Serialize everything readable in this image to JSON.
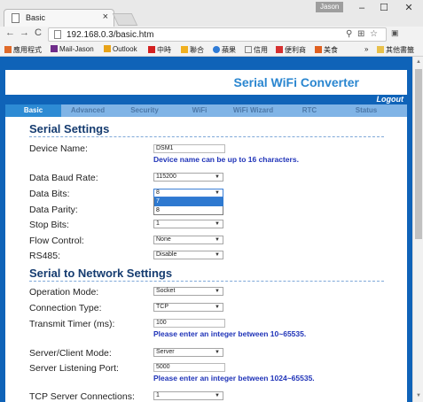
{
  "browser": {
    "tab_title": "Basic",
    "tab_close": "×",
    "user_badge": "Jason",
    "window_minimize": "–",
    "window_maximize": "☐",
    "window_close": "✕",
    "nav_back": "←",
    "nav_forward": "→",
    "nav_reload": "C",
    "url": "192.168.0.3/basic.htm",
    "menu": "⋮",
    "bookmarks": [
      "應用程式",
      "Mail-Jason",
      "Outlook",
      "中時",
      "聯合",
      "蘋果",
      "信用",
      "便利商",
      "美食"
    ],
    "bookmarks_more": "»",
    "other_bookmarks": "其他書籤"
  },
  "header": {
    "brand": "Serial WiFi Converter",
    "logout": "Logout"
  },
  "nav_tabs": [
    "Basic",
    "Advanced",
    "Security",
    "WiFi",
    "WiFi Wizard",
    "RTC",
    "Status"
  ],
  "serial_settings": {
    "title": "Serial Settings",
    "device_name_label": "Device Name:",
    "device_name_value": "DSM1",
    "device_name_hint": "Device name can be up to 16 characters.",
    "baud_rate_label": "Data Baud Rate:",
    "baud_rate_value": "115200",
    "data_bits_label": "Data Bits:",
    "data_bits_value": "8",
    "data_bits_options": [
      "7",
      "8"
    ],
    "data_parity_label": "Data Parity:",
    "stop_bits_label": "Stop Bits:",
    "stop_bits_value": "1",
    "flow_control_label": "Flow Control:",
    "flow_control_value": "None",
    "rs485_label": "RS485:",
    "rs485_value": "Disable"
  },
  "network_settings": {
    "title": "Serial to Network Settings",
    "operation_mode_label": "Operation Mode:",
    "operation_mode_value": "Socket",
    "connection_type_label": "Connection Type:",
    "connection_type_value": "TCP",
    "transmit_timer_label": "Transmit Timer (ms):",
    "transmit_timer_value": "100",
    "transmit_timer_hint": "Please enter an integer between 10~65535.",
    "server_client_label": "Server/Client Mode:",
    "server_client_value": "Server",
    "listening_port_label": "Server Listening Port:",
    "listening_port_value": "5000",
    "listening_port_hint": "Please enter an integer between 1024~65535.",
    "tcp_connections_label": "TCP Server Connections:",
    "tcp_connections_value": "1"
  },
  "colors": {
    "page_blue": "#0f63b8",
    "brand_blue": "#2a86d0",
    "hint_blue": "#1f33b8",
    "active_tab": "#2d8bd4"
  }
}
